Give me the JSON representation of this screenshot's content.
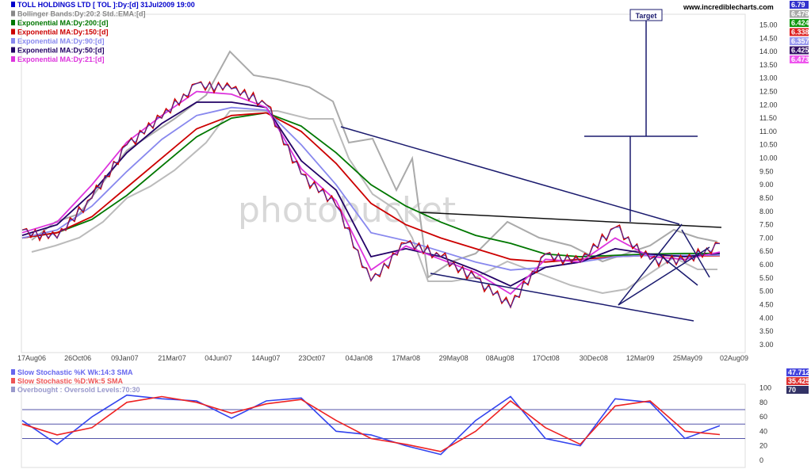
{
  "header": {
    "site": "www.incrediblecharts.com",
    "legend_main": [
      {
        "label": "TOLL HOLDINGS LTD [ TOL ]:Dy:[d]  31Jul2009 19:00",
        "color": "#0000cc",
        "value": "6.79",
        "value_bg": "#3333cc"
      },
      {
        "label": "Bollinger Bands:Dy:20:2 Std.:EMA:[d]",
        "color": "#888888",
        "value": "6.479",
        "value_bg": "#aaaaaa"
      },
      {
        "label": "Exponential MA:Dy:200:[d]",
        "color": "#007700",
        "value": "6.424",
        "value_bg": "#119911"
      },
      {
        "label": "Exponential MA:Dy:150:[d]",
        "color": "#cc0000",
        "value": "6.338",
        "value_bg": "#dd2222"
      },
      {
        "label": "Exponential MA:Dy:90:[d]",
        "color": "#8888ee",
        "value": "6.357",
        "value_bg": "#9999ee"
      },
      {
        "label": "Exponential MA:Dy:50:[d]",
        "color": "#220066",
        "value": "6.425",
        "value_bg": "#331166"
      },
      {
        "label": "Exponential MA:Dy:21:[d]",
        "color": "#dd33dd",
        "value": "6.473",
        "value_bg": "#ee55ee"
      }
    ],
    "legend_stoch": [
      {
        "label": "Slow Stochastic %K Wk:14:3 SMA",
        "color": "#6666ee",
        "value": "47.712",
        "value_bg": "#4444dd"
      },
      {
        "label": "Slow Stochastic %D:Wk:5 SMA",
        "color": "#ee5555",
        "value": "35.425",
        "value_bg": "#dd3333"
      },
      {
        "label": "Overbought : Oversold Levels:70:30",
        "color": "#9999cc",
        "value": "70",
        "value_bg": "#333366"
      }
    ]
  },
  "annotations": {
    "target_label": "Target"
  },
  "chart_data": [
    {
      "type": "line",
      "title": "TOLL HOLDINGS LTD [ TOL ]:Dy:[d]  31Jul2009 19:00",
      "x_tick_labels": [
        "17Aug06",
        "26Oct06",
        "09Jan07",
        "21Mar07",
        "04Jun07",
        "14Aug07",
        "23Oct07",
        "04Jan08",
        "17Mar08",
        "29May08",
        "08Aug08",
        "17Oct08",
        "30Dec08",
        "12Mar09",
        "25May09",
        "02Aug09"
      ],
      "y_tick_labels": [
        "15.00",
        "14.50",
        "14.00",
        "13.50",
        "13.00",
        "12.50",
        "12.00",
        "11.50",
        "11.00",
        "10.50",
        "10.00",
        "9.50",
        "9.00",
        "8.50",
        "8.00",
        "7.50",
        "7.00",
        "6.50",
        "6.00",
        "5.50",
        "5.00",
        "4.50",
        "4.00",
        "3.50",
        "3.00"
      ],
      "ylim": [
        2.7,
        15.4
      ],
      "grid": false,
      "x": [
        0,
        0.05,
        0.1,
        0.15,
        0.2,
        0.25,
        0.3,
        0.35,
        0.4,
        0.45,
        0.5,
        0.55,
        0.6,
        0.65,
        0.7,
        0.75,
        0.8,
        0.85,
        0.9,
        0.95,
        1
      ],
      "series": [
        {
          "name": "TOLL HOLDINGS LTD [ TOL ]",
          "color": "#cc0000",
          "values": [
            7.3,
            7.0,
            8.5,
            10.5,
            11.5,
            12.8,
            12.6,
            12.0,
            9.4,
            8.2,
            5.4,
            6.8,
            6.3,
            5.5,
            4.4,
            6.4,
            6.1,
            7.4,
            6.2,
            6.1,
            6.79
          ]
        },
        {
          "name": "Exponential MA:Dy:200:[d]",
          "color": "#007700",
          "values": [
            7.0,
            7.2,
            7.7,
            8.6,
            9.7,
            10.8,
            11.5,
            11.7,
            11.2,
            10.2,
            9.0,
            8.2,
            7.6,
            7.1,
            6.8,
            6.4,
            6.3,
            6.35,
            6.4,
            6.42,
            6.424
          ]
        },
        {
          "name": "Exponential MA:Dy:150:[d]",
          "color": "#cc0000",
          "values": [
            7.0,
            7.2,
            7.8,
            8.9,
            10.0,
            11.1,
            11.6,
            11.7,
            11.0,
            9.8,
            8.3,
            7.5,
            7.0,
            6.6,
            6.2,
            6.1,
            6.2,
            6.3,
            6.35,
            6.33,
            6.338
          ]
        },
        {
          "name": "Exponential MA:Dy:90:[d]",
          "color": "#8888ee",
          "values": [
            7.0,
            7.3,
            8.2,
            9.5,
            10.7,
            11.6,
            11.9,
            11.8,
            10.5,
            9.0,
            7.2,
            6.9,
            6.5,
            6.1,
            5.8,
            5.9,
            6.1,
            6.3,
            6.35,
            6.35,
            6.357
          ]
        },
        {
          "name": "Exponential MA:Dy:50:[d]",
          "color": "#220066",
          "values": [
            7.1,
            7.5,
            8.7,
            10.2,
            11.3,
            12.1,
            12.1,
            11.9,
            9.9,
            8.8,
            6.3,
            6.6,
            6.3,
            5.8,
            5.2,
            5.9,
            6.1,
            6.6,
            6.4,
            6.3,
            6.425
          ]
        },
        {
          "name": "Exponential MA:Dy:21:[d]",
          "color": "#dd33dd",
          "values": [
            7.2,
            7.6,
            9.0,
            10.6,
            11.6,
            12.5,
            12.4,
            11.9,
            9.6,
            8.4,
            5.8,
            6.7,
            6.2,
            5.7,
            4.9,
            6.2,
            6.1,
            7.0,
            6.3,
            6.2,
            6.473
          ]
        }
      ]
    },
    {
      "type": "line",
      "title": "Slow Stochastic",
      "y_tick_labels": [
        "100",
        "80",
        "60",
        "40",
        "20",
        "0"
      ],
      "ylim": [
        -10,
        105
      ],
      "levels": [
        70,
        30
      ],
      "grid": false,
      "x": [
        0,
        0.05,
        0.1,
        0.15,
        0.2,
        0.25,
        0.3,
        0.35,
        0.4,
        0.45,
        0.5,
        0.55,
        0.6,
        0.65,
        0.7,
        0.75,
        0.8,
        0.85,
        0.9,
        0.95,
        1
      ],
      "series": [
        {
          "name": "Slow Stochastic %K Wk:14:3 SMA",
          "color": "#3344ee",
          "values": [
            55,
            22,
            60,
            90,
            85,
            82,
            58,
            82,
            86,
            40,
            35,
            20,
            8,
            55,
            88,
            30,
            20,
            85,
            80,
            30,
            47.712
          ]
        },
        {
          "name": "Slow Stochastic %D:Wk:5 SMA",
          "color": "#ee2222",
          "values": [
            50,
            35,
            45,
            80,
            88,
            80,
            65,
            78,
            84,
            55,
            30,
            22,
            12,
            40,
            82,
            45,
            22,
            75,
            82,
            40,
            35.425
          ]
        }
      ]
    }
  ]
}
